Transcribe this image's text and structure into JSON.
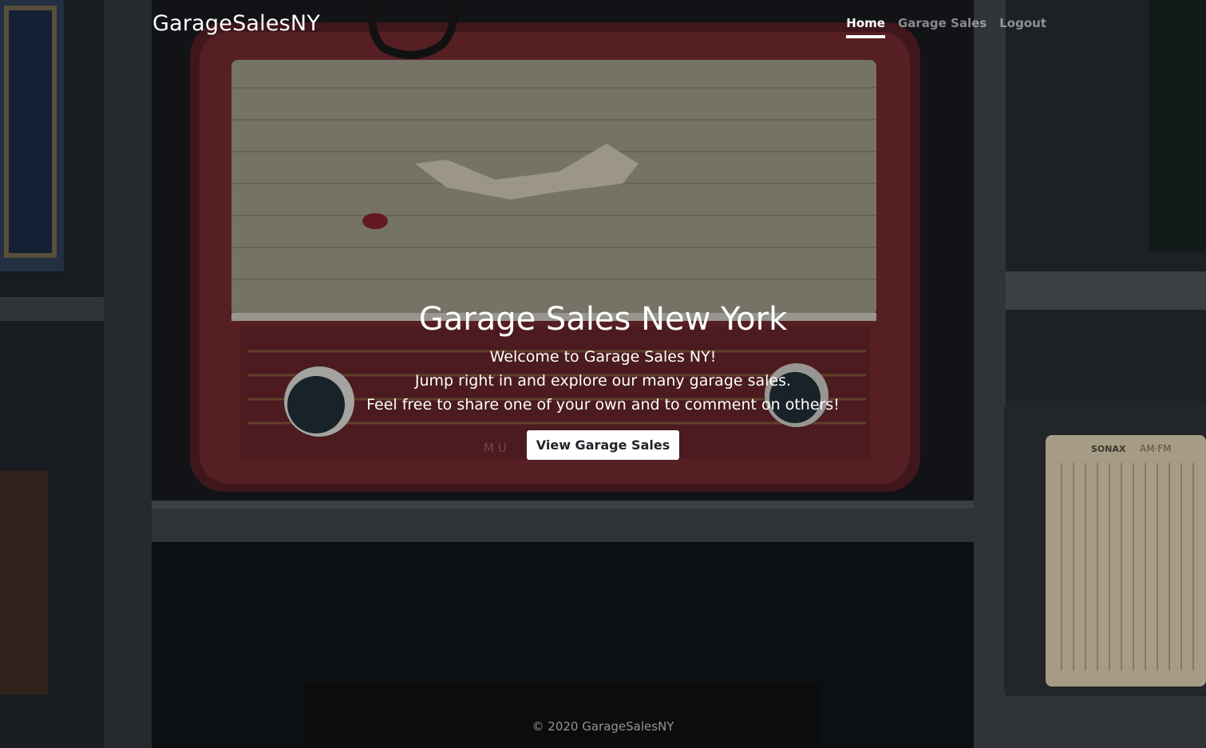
{
  "brand": "GarageSalesNY",
  "nav": {
    "home": "Home",
    "garage_sales": "Garage Sales",
    "logout": "Logout"
  },
  "hero": {
    "title": "Garage Sales New York",
    "lines": [
      "Welcome to Garage Sales NY!",
      "Jump right in and explore our many garage sales.",
      "Feel free to share one of your own and to comment on others!"
    ],
    "button_label": "View Garage Sales"
  },
  "footer": {
    "copyright": "© 2020 GarageSalesNY"
  },
  "background": {
    "photo_markings": {
      "dial_letters": "M  U",
      "radio_brand": "SONAX",
      "radio_band": "AM·FM"
    }
  },
  "colors": {
    "radio_body": "#5a1f24",
    "grille": "#9c9787",
    "shelf_wood": "#3d4146",
    "overlay": "rgba(0,0,0,0.18)"
  }
}
